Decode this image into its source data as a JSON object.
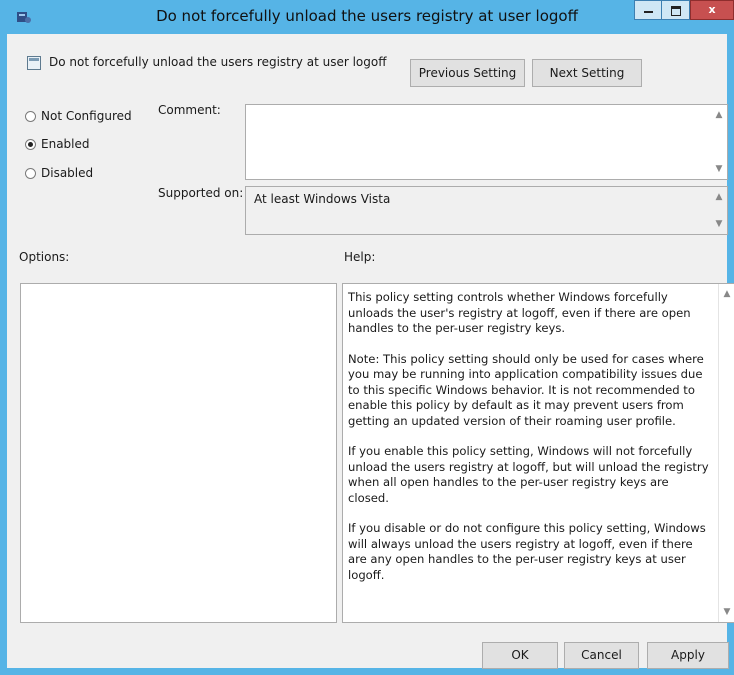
{
  "window": {
    "title": "Do not forcefully unload the users registry at user logoff",
    "minimize_glyph": "",
    "close_glyph": "x",
    "accent_color": "#56b4e6"
  },
  "header": {
    "setting_name": "Do not forcefully unload the users registry at user logoff",
    "previous_label": "Previous Setting",
    "next_label": "Next Setting"
  },
  "state": {
    "options": [
      {
        "label": "Not Configured",
        "checked": false
      },
      {
        "label": "Enabled",
        "checked": true
      },
      {
        "label": "Disabled",
        "checked": false
      }
    ]
  },
  "comment": {
    "label": "Comment:",
    "value": ""
  },
  "supported": {
    "label": "Supported on:",
    "value": "At least Windows Vista"
  },
  "options_label": "Options:",
  "help": {
    "label": "Help:",
    "paragraphs": [
      "This policy setting  controls whether Windows forcefully unloads the user's registry at logoff, even if there are open handles to the per-user registry keys.",
      "Note: This policy setting should only be used for cases where you may be running into application compatibility issues due to this specific Windows behavior. It is not recommended to enable this policy by default as it may prevent users from getting an updated version of their roaming user profile.",
      "If you enable this policy setting, Windows will not forcefully unload the users registry at logoff, but will unload the registry when all open handles to the per-user registry keys are closed.",
      "If you disable or do not configure this policy setting, Windows will always unload the users registry at logoff, even if there are any open handles to the per-user registry keys at user logoff."
    ]
  },
  "footer": {
    "ok_label": "OK",
    "cancel_label": "Cancel",
    "apply_label": "Apply"
  },
  "icons": {
    "app": "policy-app-icon",
    "setting": "policy-setting-icon",
    "scroll_up": "▲",
    "scroll_down": "▼"
  }
}
